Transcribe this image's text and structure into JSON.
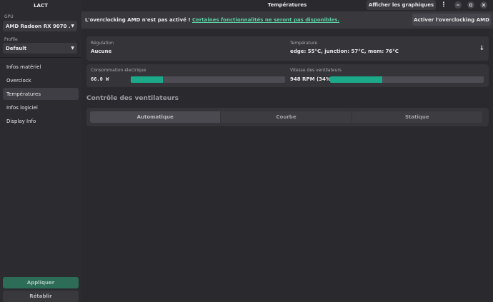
{
  "app": {
    "title": "LACT"
  },
  "sidebar": {
    "gpu_label": "GPU",
    "gpu_value": "AMD Radeon RX 9070 ...",
    "profile_label": "Profile",
    "profile_value": "Default",
    "items": [
      {
        "label": "Infos matériel",
        "active": false
      },
      {
        "label": "Overclock",
        "active": false
      },
      {
        "label": "Températures",
        "active": true
      },
      {
        "label": "Infos logiciel",
        "active": false
      },
      {
        "label": "Display Info",
        "active": false
      }
    ],
    "apply_label": "Appliquer",
    "reset_label": "Rétablir"
  },
  "header": {
    "title": "Températures",
    "graphs_button": "Afficher les graphiques",
    "menu_icon": "⋮",
    "minimize_icon": "minimize-icon",
    "restore_icon": "restore-icon",
    "close_icon": "close-icon"
  },
  "banner": {
    "text": "L'overclocking AMD n'est pas activé ! ",
    "link": "Certaines fonctionnalités ne seront pas disponibles.",
    "button": "Activer l'overclocking AMD"
  },
  "stats": {
    "regulation_label": "Régulation",
    "regulation_value": "Aucune",
    "temperature_label": "Température",
    "temperature_value": "edge: 55°C, junction: 57°C, mem: 76°C",
    "power_label": "Consommation électrique",
    "power_value": "66.0 W",
    "power_fraction": 0.21,
    "fan_label": "Vitesse des ventilateurs",
    "fan_value": "948 RPM (34%)",
    "fan_fraction": 0.34
  },
  "fan_control": {
    "title": "Contrôle des ventilateurs",
    "modes": [
      "Automatique",
      "Courbe",
      "Statique"
    ]
  },
  "colors": {
    "accent": "#1ba98a",
    "link": "#5fd1a4",
    "apply": "#2d6c57"
  }
}
